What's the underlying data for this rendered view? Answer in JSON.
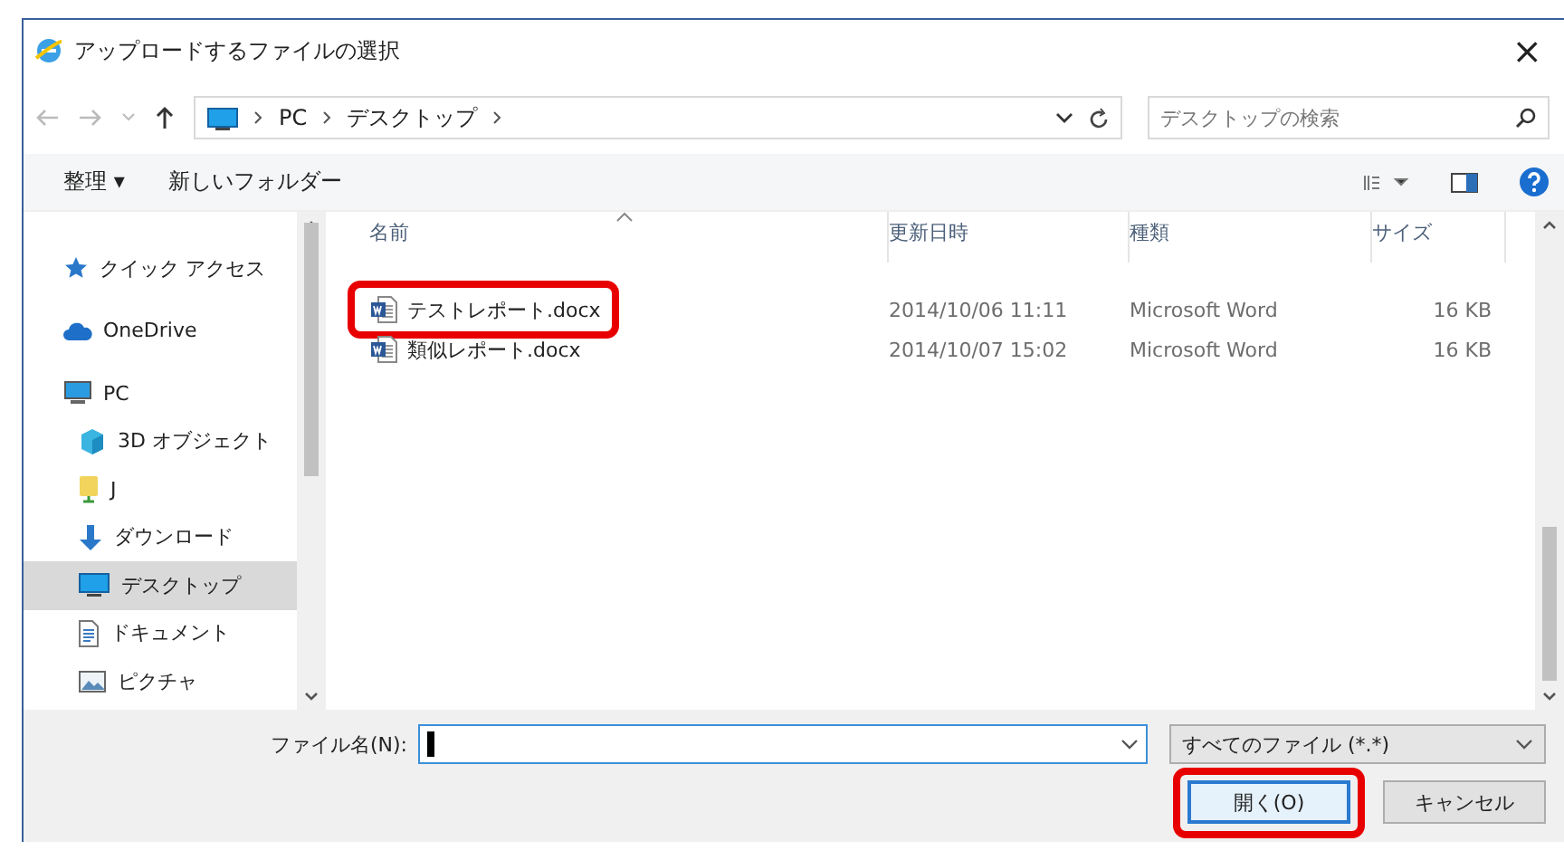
{
  "window": {
    "title": "アップロードするファイルの選択",
    "close": "×"
  },
  "address": {
    "path": [
      "PC",
      "デスクトップ"
    ],
    "search": {
      "placeholder": "デスクトップの検索"
    }
  },
  "toolbar": {
    "items": [
      "整理 ▾",
      "新しいフォルダー"
    ]
  },
  "sidebar": {
    "items": [
      {
        "label": "クイック アクセス",
        "kind": "star",
        "selected": false
      },
      {
        "label": "OneDrive",
        "kind": "cloud",
        "selected": false
      },
      {
        "label": "PC",
        "kind": "pc",
        "selected": false,
        "children": [
          {
            "label": "3D オブジェクト",
            "kind": "cube",
            "selected": false
          },
          {
            "label": "J",
            "kind": "drive",
            "selected": false
          },
          {
            "label": "ダウンロード",
            "kind": "download",
            "selected": false
          },
          {
            "label": "デスクトップ",
            "kind": "desktop",
            "selected": true
          },
          {
            "label": "ドキュメント",
            "kind": "document",
            "selected": false
          },
          {
            "label": "ピクチャ",
            "kind": "image",
            "selected": false
          }
        ]
      }
    ]
  },
  "table": {
    "columns": [
      "名前",
      "更新日時",
      "種類",
      "サイズ"
    ],
    "rows": [
      {
        "name": "テストレポート.docx",
        "modified": "2014/10/06 11:11",
        "type": "Microsoft Word",
        "size": "16 KB",
        "highlighted": true
      },
      {
        "name": "類似レポート.docx",
        "modified": "2014/10/07 15:02",
        "type": "Microsoft Word",
        "size": "16 KB",
        "highlighted": false
      }
    ]
  },
  "footer": {
    "filename_label": "ファイル名(N):",
    "filter": "すべてのファイル (*.*)",
    "buttons": [
      {
        "label": "開く(O)",
        "highlighted": true
      },
      {
        "label": "キャンセル",
        "highlighted": false
      }
    ]
  }
}
